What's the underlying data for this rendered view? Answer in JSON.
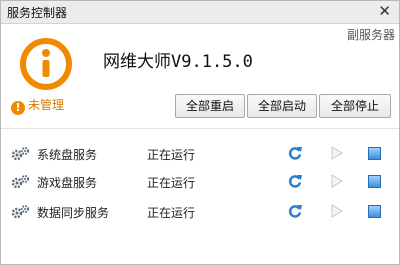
{
  "window": {
    "title": "服务控制器",
    "close_glyph": "✕"
  },
  "secondary_server_label": "副服务器",
  "app": {
    "name": "网维大师V9.1.5.0",
    "logo_icon": "info-icon",
    "logo_color": "#f08a00"
  },
  "status": {
    "icon": "warning-icon",
    "text": "未管理",
    "color": "#d47b00"
  },
  "actions": {
    "restart_all": "全部重启",
    "start_all": "全部启动",
    "stop_all": "全部停止"
  },
  "services": [
    {
      "name": "系统盘服务",
      "state": "正在运行"
    },
    {
      "name": "游戏盘服务",
      "state": "正在运行"
    },
    {
      "name": "数据同步服务",
      "state": "正在运行"
    }
  ]
}
